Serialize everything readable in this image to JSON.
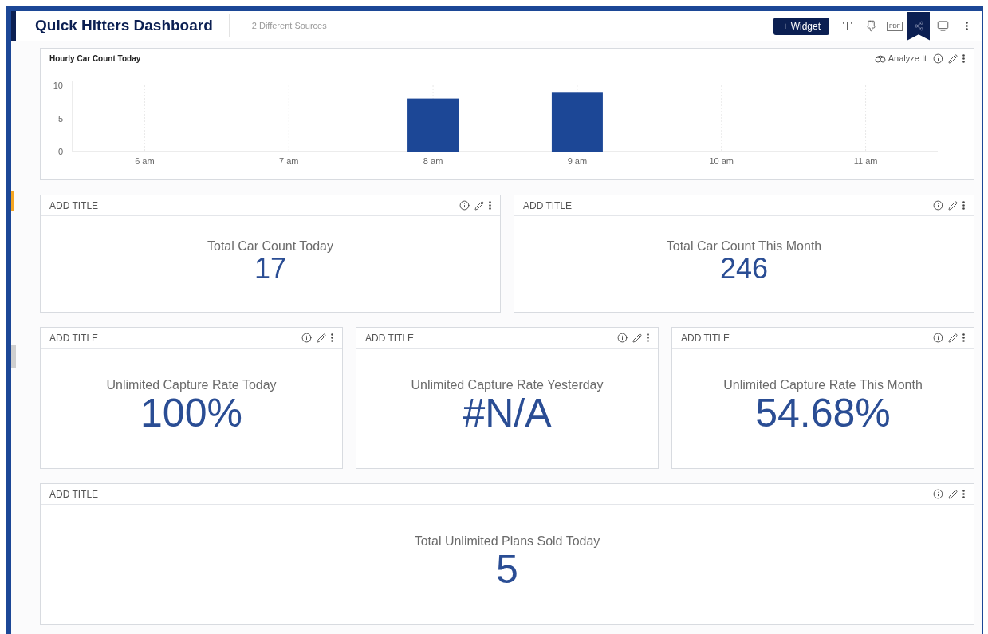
{
  "header": {
    "title": "Quick Hitters Dashboard",
    "subtitle": "2 Different Sources",
    "widget_button": "+ Widget",
    "toolbar": [
      {
        "kind": "text",
        "selected": false
      },
      {
        "kind": "brush",
        "selected": false
      },
      {
        "kind": "pdf",
        "label": "PDF",
        "selected": false
      },
      {
        "kind": "share",
        "selected": true
      },
      {
        "kind": "monitor",
        "selected": false
      },
      {
        "kind": "more",
        "selected": false
      }
    ]
  },
  "chart_widget": {
    "title": "Hourly Car Count Today",
    "analyze": "Analyze It",
    "chart_data": {
      "type": "bar",
      "categories": [
        "6 am",
        "7 am",
        "8 am",
        "9 am",
        "10 am",
        "11 am"
      ],
      "grid": true,
      "series": [
        {
          "color": "#1c4796",
          "values": [
            0,
            0,
            8,
            9,
            0,
            0
          ]
        }
      ],
      "ylim": [
        0,
        10
      ],
      "yticks": [
        0,
        5,
        10
      ]
    }
  },
  "kpi_rows": [
    [
      {
        "title": "ADD TITLE",
        "label": "Total Car Count Today",
        "value": "17"
      },
      {
        "title": "ADD TITLE",
        "label": "Total Car Count This Month",
        "value": "246"
      }
    ],
    [
      {
        "title": "ADD TITLE",
        "label": "Unlimited Capture Rate Today",
        "value": "100%"
      },
      {
        "title": "ADD TITLE",
        "label": "Unlimited Capture Rate Yesterday",
        "value": "#N/A"
      },
      {
        "title": "ADD TITLE",
        "label": "Unlimited Capture Rate This Month",
        "value": "54.68%"
      }
    ],
    [
      {
        "title": "ADD TITLE",
        "label": "Total Unlimited Plans Sold Today",
        "value": "5"
      }
    ]
  ]
}
